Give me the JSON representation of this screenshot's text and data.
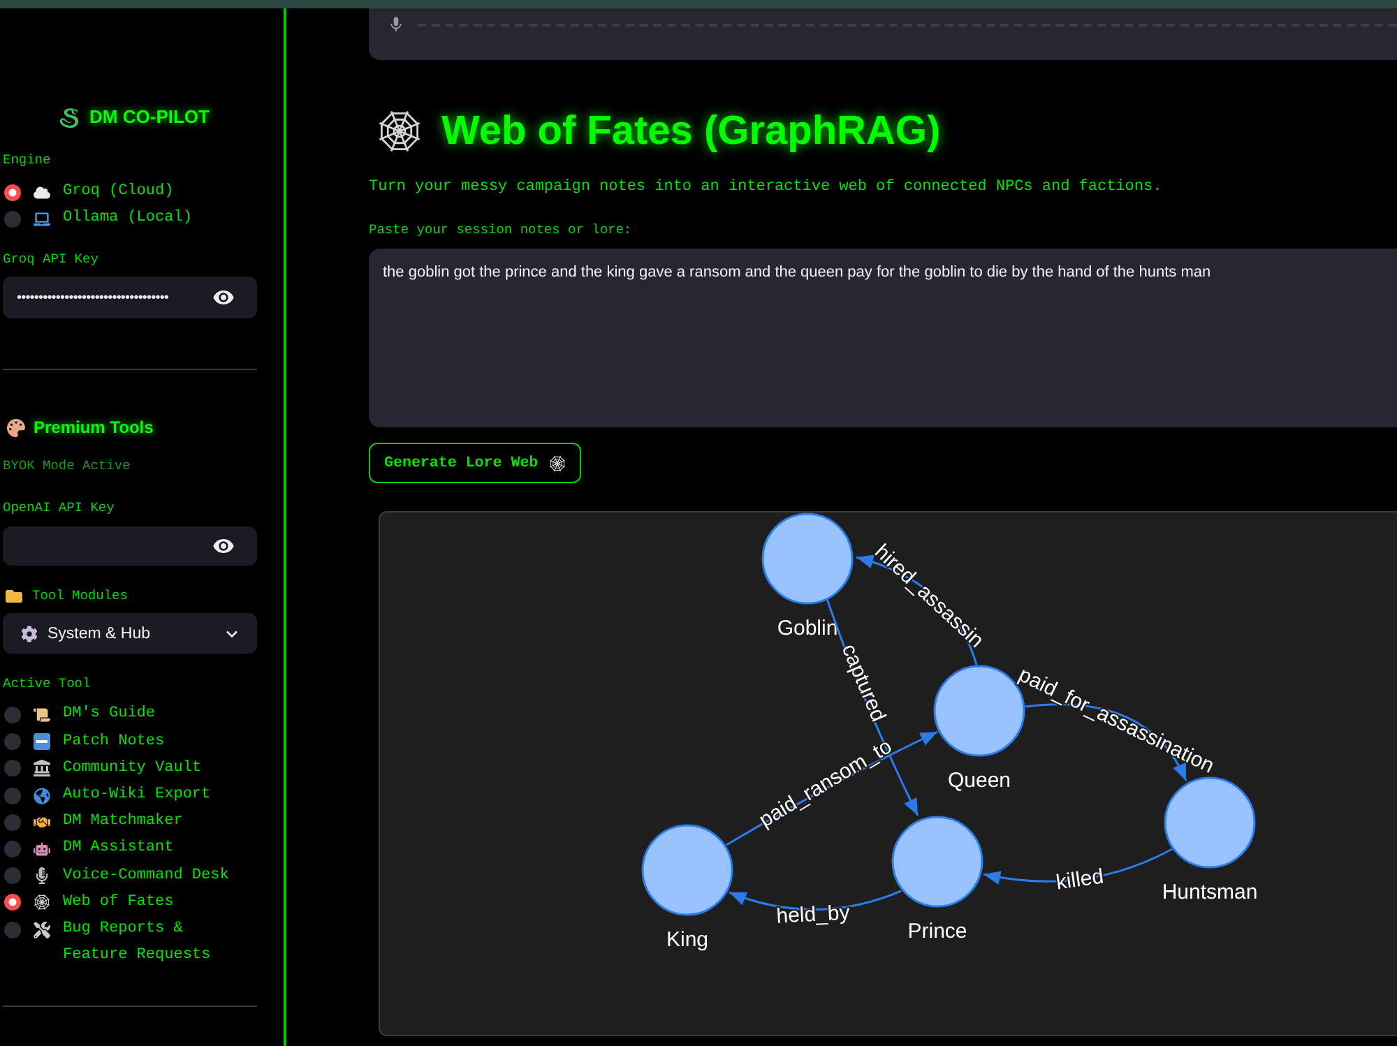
{
  "sidebar": {
    "title": "DM CO-PILOT",
    "engine": {
      "label": "Engine",
      "options": [
        {
          "label": "Groq (Cloud)",
          "selected": true
        },
        {
          "label": "Ollama (Local)",
          "selected": false
        }
      ]
    },
    "groq_api_key": {
      "label": "Groq API Key",
      "value": "•••••••••••••••••••••••••••••••••••"
    },
    "premium_tools": {
      "title": "Premium Tools",
      "status": "BYOK Mode Active",
      "openai_api_key": {
        "label": "OpenAI API Key"
      }
    },
    "tool_modules": {
      "label": "Tool Modules",
      "value": "System & Hub"
    },
    "active_tool": {
      "label": "Active Tool",
      "options": [
        {
          "label": "DM's Guide",
          "selected": false
        },
        {
          "label": "Patch Notes",
          "selected": false
        },
        {
          "label": "Community Vault",
          "selected": false
        },
        {
          "label": "Auto-Wiki Export",
          "selected": false
        },
        {
          "label": "DM Matchmaker",
          "selected": false
        },
        {
          "label": "DM Assistant",
          "selected": false
        },
        {
          "label": "Voice-Command Desk",
          "selected": false
        },
        {
          "label": "Web of Fates",
          "selected": true
        },
        {
          "label": "Bug Reports & Feature Requests",
          "selected": false
        }
      ]
    }
  },
  "main": {
    "title": "Web of Fates (GraphRAG)",
    "description": "Turn your messy campaign notes into an interactive web of connected NPCs and factions.",
    "notes": {
      "label": "Paste your session notes or lore:",
      "value": "the goblin got the prince and the king gave a ransom and the queen pay for the goblin to die by the hand of the hunts man"
    },
    "generate_button": "Generate Lore Web",
    "graph": {
      "nodes": [
        {
          "label": "Goblin"
        },
        {
          "label": "Queen"
        },
        {
          "label": "Huntsman"
        },
        {
          "label": "Prince"
        },
        {
          "label": "King"
        }
      ],
      "edges": [
        {
          "label": "hired_assassin"
        },
        {
          "label": "captured"
        },
        {
          "label": "paid_for_assassination"
        },
        {
          "label": "paid_ransom_to"
        },
        {
          "label": "killed"
        },
        {
          "label": "held_by"
        }
      ]
    }
  }
}
